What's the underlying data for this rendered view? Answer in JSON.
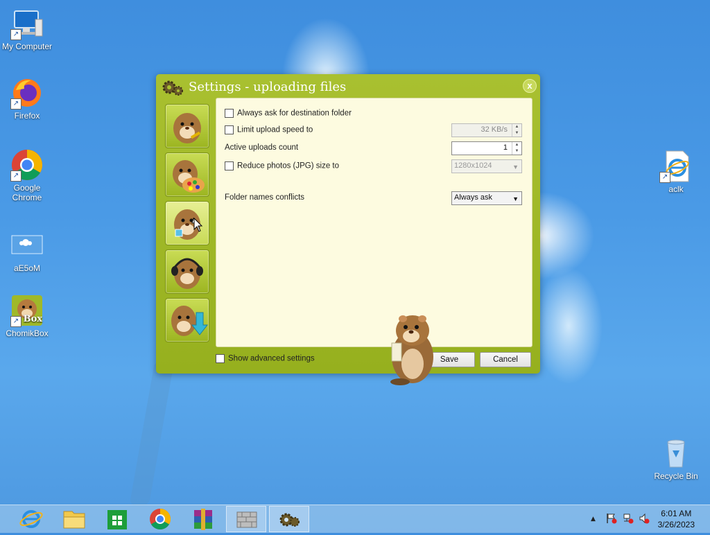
{
  "desktop": {
    "icons": [
      {
        "label": "My Computer",
        "icon": "computer-icon"
      },
      {
        "label": "Firefox",
        "icon": "firefox-icon"
      },
      {
        "label": "Google Chrome",
        "icon": "chrome-icon"
      },
      {
        "label": "aE5oM",
        "icon": "image-file-icon"
      },
      {
        "label": "ChomikBox",
        "icon": "chomikbox-icon"
      },
      {
        "label": "aclk",
        "icon": "ie-file-icon"
      },
      {
        "label": "Recycle Bin",
        "icon": "recycle-bin-icon"
      }
    ]
  },
  "dialog": {
    "title": "Settings - uploading files",
    "close_label": "x",
    "sidebar": [
      {
        "name": "general-settings",
        "icon": "hamster-key-icon"
      },
      {
        "name": "appearance-settings",
        "icon": "hamster-palette-icon"
      },
      {
        "name": "uploading-settings",
        "icon": "hamster-upload-icon"
      },
      {
        "name": "downloading-settings",
        "icon": "hamster-headphones-icon"
      },
      {
        "name": "transfer-settings",
        "icon": "hamster-download-icon"
      }
    ],
    "options": {
      "ask_destination": {
        "label": "Always ask for destination folder",
        "checked": false
      },
      "limit_speed": {
        "label": "Limit upload speed to",
        "checked": false,
        "value": "32 KB/s"
      },
      "active_uploads": {
        "label": "Active uploads count",
        "value": "1"
      },
      "reduce_photos": {
        "label": "Reduce photos (JPG) size to",
        "checked": false,
        "value": "1280x1024"
      },
      "folder_conflicts": {
        "label": "Folder names conflicts",
        "value": "Always ask"
      }
    },
    "show_advanced": {
      "label": "Show advanced settings",
      "checked": false
    },
    "save_label": "Save",
    "cancel_label": "Cancel"
  },
  "taskbar": {
    "items": [
      {
        "name": "ie",
        "icon": "internet-explorer-icon"
      },
      {
        "name": "file-explorer",
        "icon": "folder-icon"
      },
      {
        "name": "store",
        "icon": "store-icon"
      },
      {
        "name": "chrome",
        "icon": "chrome-icon"
      },
      {
        "name": "winrar",
        "icon": "winrar-icon"
      },
      {
        "name": "app-window",
        "icon": "wall-icon"
      },
      {
        "name": "chomikbox-settings",
        "icon": "gear-icon"
      }
    ],
    "tray_icons": [
      "up-arrow-icon",
      "flag-icon",
      "network-icon",
      "volume-muted-icon"
    ],
    "time": "6:01 AM",
    "date": "3/26/2023"
  },
  "colors": {
    "dialog_green": "#a2ba28",
    "panel_bg": "#fdfbe0",
    "accent_blue": "#1e78d7"
  }
}
